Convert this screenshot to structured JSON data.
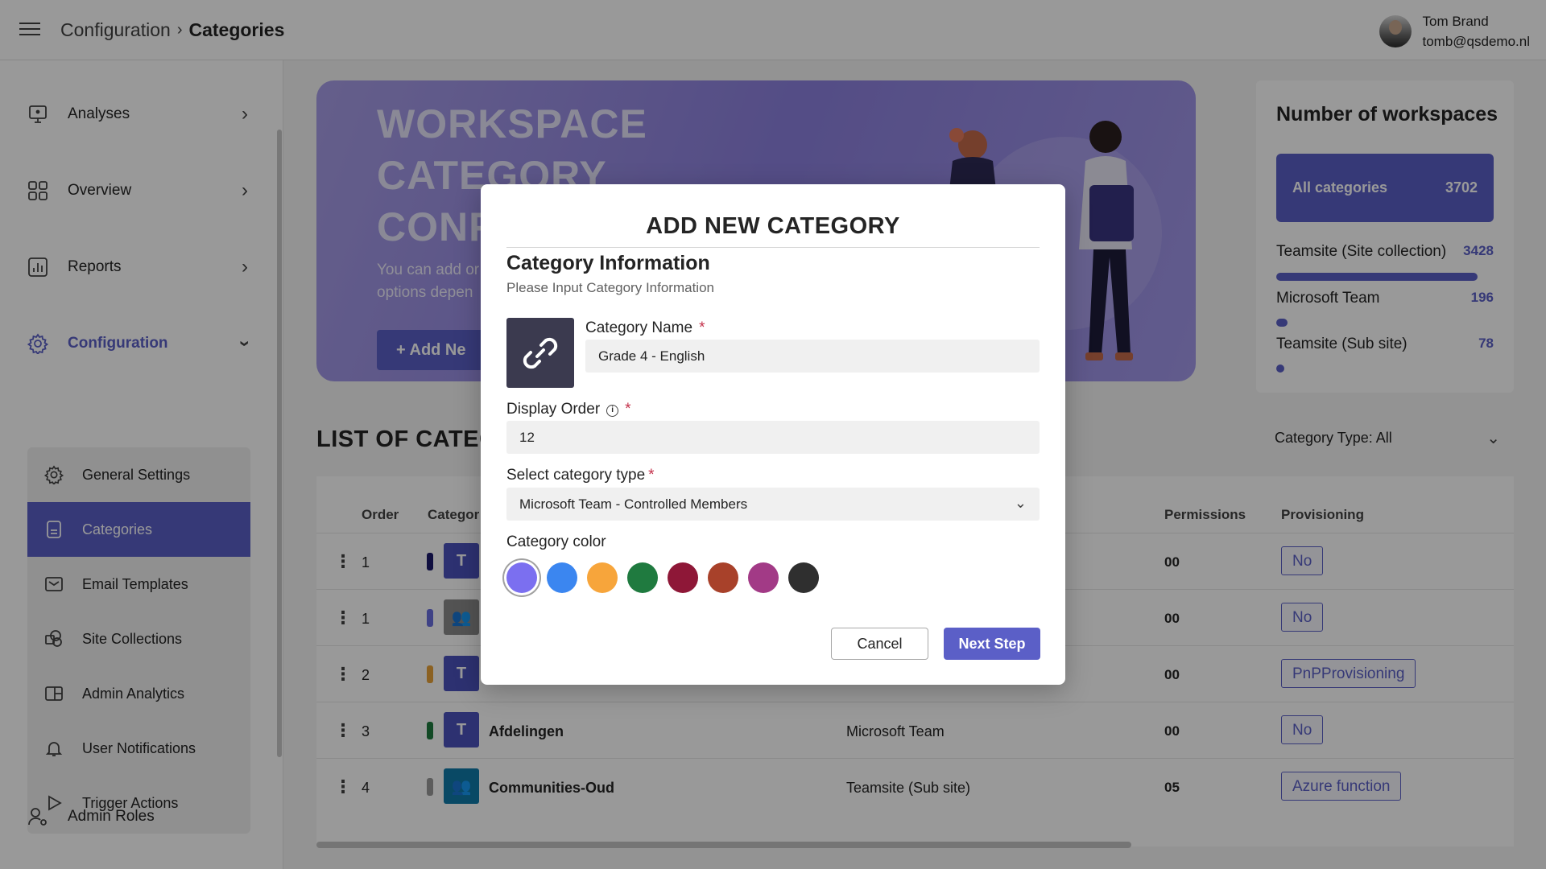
{
  "header": {
    "breadcrumb_parent": "Configuration",
    "breadcrumb_sep": "›",
    "breadcrumb_current": "Categories",
    "user_name": "Tom Brand",
    "user_email": "tomb@qsdemo.nl"
  },
  "sidebar": {
    "items": [
      {
        "label": "Analyses",
        "icon": "monitor-icon"
      },
      {
        "label": "Overview",
        "icon": "grid-icon"
      },
      {
        "label": "Reports",
        "icon": "bar-chart-icon"
      },
      {
        "label": "Configuration",
        "icon": "gear-icon"
      }
    ],
    "submenu": [
      {
        "label": "General Settings",
        "icon": "gear-icon"
      },
      {
        "label": "Categories",
        "icon": "document-icon"
      },
      {
        "label": "Email Templates",
        "icon": "mail-icon"
      },
      {
        "label": "Site Collections",
        "icon": "sharepoint-icon"
      },
      {
        "label": "Admin Analytics",
        "icon": "layout-icon"
      },
      {
        "label": "User Notifications",
        "icon": "bell-icon"
      },
      {
        "label": "Trigger Actions",
        "icon": "play-icon"
      }
    ],
    "admin_roles": "Admin Roles"
  },
  "banner": {
    "title_line1": "WORKSPACE",
    "title_line2": "CATEGORY",
    "title_line3": "CONF",
    "desc_line1": "You can add or",
    "desc_line2": "options depen",
    "button_label": "+ Add Ne"
  },
  "workspaces": {
    "title": "Number of workspaces",
    "all_label": "All categories",
    "all_count": "3702",
    "rows": [
      {
        "label": "Teamsite (Site collection)",
        "count": "3428",
        "fraction": 0.926
      },
      {
        "label": "Microsoft Team",
        "count": "196",
        "fraction": 0.053
      },
      {
        "label": "Teamsite (Sub site)",
        "count": "78",
        "fraction": 0.021
      }
    ]
  },
  "list": {
    "title": "LIST OF CATEG",
    "filter": "Category Type: All",
    "headers": {
      "order": "Order",
      "category": "Categor",
      "permissions": "Permissions",
      "provisioning": "Provisioning"
    },
    "rows": [
      {
        "order": "1",
        "color": "#1b1a6b",
        "icon_bg": "#4b53bc",
        "icon_text": "T",
        "name": "",
        "type": "",
        "perm": "00",
        "prov": "No"
      },
      {
        "order": "1",
        "color": "#6a6ee0",
        "icon_bg": "#8a8a8a",
        "icon_text": "👥",
        "name": "",
        "type": "",
        "perm": "00",
        "prov": "No"
      },
      {
        "order": "2",
        "color": "#e8a23a",
        "icon_bg": "#4b53bc",
        "icon_text": "T",
        "name": "",
        "type": "",
        "perm": "00",
        "prov": "PnPProvisioning"
      },
      {
        "order": "3",
        "color": "#1f7a3f",
        "icon_bg": "#4b53bc",
        "icon_text": "T",
        "name": "Afdelingen",
        "type": "Microsoft Team",
        "perm": "00",
        "prov": "No"
      },
      {
        "order": "4",
        "color": "#9a9a9a",
        "icon_bg": "#0f7aa8",
        "icon_text": "👥",
        "name": "Communities-Oud",
        "type": "Teamsite (Sub site)",
        "perm": "05",
        "prov": "Azure function"
      }
    ]
  },
  "modal": {
    "title": "ADD NEW CATEGORY",
    "section_title": "Category Information",
    "section_sub": "Please Input Category Information",
    "name_label": "Category Name",
    "name_value": "Grade 4 - English",
    "order_label": "Display Order",
    "order_value": "12",
    "type_label": "Select category type",
    "type_value": "Microsoft Team - Controlled Members",
    "color_label": "Category color",
    "required_mark": "*",
    "info_mark": "i",
    "colors": [
      "#7b6ff0",
      "#3b86f0",
      "#f7a53b",
      "#1f7a3f",
      "#8e1737",
      "#a8412a",
      "#a23a86",
      "#2f2f2f"
    ],
    "selected_color": "#7b6ff0",
    "cancel_label": "Cancel",
    "next_label": "Next Step"
  }
}
